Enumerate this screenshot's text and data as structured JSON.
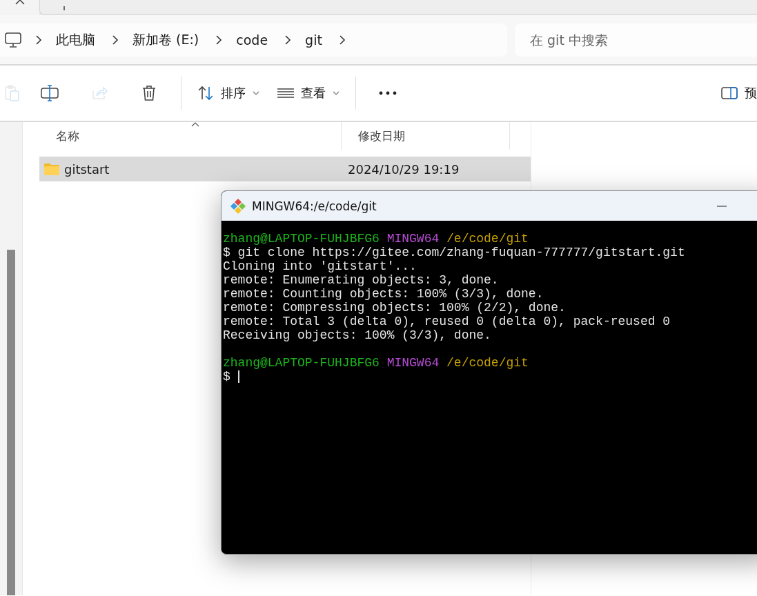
{
  "breadcrumb": {
    "items": [
      "此电脑",
      "新加卷 (E:)",
      "code",
      "git"
    ]
  },
  "search": {
    "placeholder": "在 git 中搜索"
  },
  "toolbar": {
    "items": [
      {
        "kind": "paste",
        "disabled": true
      },
      {
        "kind": "rename",
        "disabled": false
      },
      {
        "kind": "share",
        "disabled": true
      },
      {
        "kind": "delete",
        "disabled": false
      },
      {
        "kind": "sort",
        "label": "排序",
        "disabled": false
      },
      {
        "kind": "view",
        "label": "查看",
        "disabled": false
      },
      {
        "kind": "more",
        "disabled": false
      }
    ],
    "preview": {
      "label": "预"
    }
  },
  "table": {
    "columns": [
      {
        "label": "名称",
        "sorted": true
      },
      {
        "label": "修改日期",
        "sorted": false
      }
    ],
    "rows": [
      {
        "name": "gitstart",
        "modified": "2024/10/29 19:19",
        "selected": true
      }
    ]
  },
  "terminal": {
    "title": "MINGW64:/e/code/git",
    "lines": [
      [
        {
          "text": "zhang@LAPTOP-FUHJBFG6 ",
          "color": "#1cb51c"
        },
        {
          "text": "MINGW64 ",
          "color": "#b84cd6"
        },
        {
          "text": "/e/code/git",
          "color": "#c6a100"
        }
      ],
      [
        {
          "text": "$ git clone https://gitee.com/zhang-fuquan-777777/gitstart.git",
          "color": "#e6e6e6"
        }
      ],
      [
        {
          "text": "Cloning into 'gitstart'...",
          "color": "#e6e6e6"
        }
      ],
      [
        {
          "text": "remote: Enumerating objects: 3, done.",
          "color": "#e6e6e6"
        }
      ],
      [
        {
          "text": "remote: Counting objects: 100% (3/3), done.",
          "color": "#e6e6e6"
        }
      ],
      [
        {
          "text": "remote: Compressing objects: 100% (2/2), done.",
          "color": "#e6e6e6"
        }
      ],
      [
        {
          "text": "remote: Total 3 (delta 0), reused 0 (delta 0), pack-reused 0",
          "color": "#e6e6e6"
        }
      ],
      [
        {
          "text": "Receiving objects: 100% (3/3), done.",
          "color": "#e6e6e6"
        }
      ],
      {
        "kind": "blank"
      },
      [
        {
          "text": "zhang@LAPTOP-FUHJBFG6 ",
          "color": "#1cb51c"
        },
        {
          "text": "MINGW64 ",
          "color": "#b84cd6"
        },
        {
          "text": "/e/code/git",
          "color": "#c6a100"
        }
      ],
      [
        {
          "text": "$",
          "color": "#e6e6e6"
        }
      ]
    ],
    "cursor": true
  }
}
